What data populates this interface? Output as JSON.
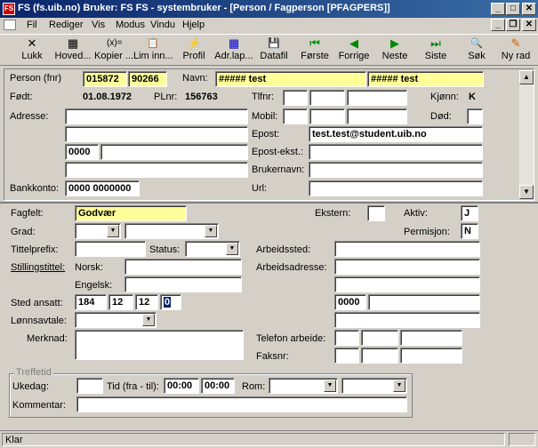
{
  "window": {
    "title": "FS (fs.uib.no) Bruker: FS  FS - systembruker - [Person / Fagperson    [PFAGPERS]]",
    "app_icon_text": "FS"
  },
  "menu": [
    "Fil",
    "Rediger",
    "Vis",
    "Modus",
    "Vindu",
    "Hjelp"
  ],
  "toolbar": [
    {
      "label": "Lukk",
      "icon": "✕"
    },
    {
      "label": "Hoved...",
      "icon": "▦"
    },
    {
      "label": "Kopier ...",
      "icon": "(x)="
    },
    {
      "label": "Lim inn...",
      "icon": "📋"
    },
    {
      "label": "Profil",
      "icon": "⚡"
    },
    {
      "label": "Adr.lap...",
      "icon": "▦"
    },
    {
      "label": "Datafil",
      "icon": "💾"
    },
    {
      "label": "Første",
      "icon": "⏮"
    },
    {
      "label": "Forrige",
      "icon": "◀"
    },
    {
      "label": "Neste",
      "icon": "▶"
    },
    {
      "label": "Siste",
      "icon": "⏭"
    },
    {
      "label": "Søk",
      "icon": "🔍"
    },
    {
      "label": "Ny rad",
      "icon": "✎"
    }
  ],
  "person": {
    "fnr_label": "Person  (fnr)",
    "fnr1": "015872",
    "fnr2": "90266",
    "navn_label": "Navn:",
    "navn1": "##### test",
    "navn2": "##### test",
    "fodt_label": "Født:",
    "fodt": "01.08.1972",
    "plnr_label": "PLnr:",
    "plnr": "156763",
    "tlfnr_label": "Tlfnr:",
    "kjonn_label": "Kjønn:",
    "kjonn": "K",
    "adresse_label": "Adresse:",
    "mobil_label": "Mobil:",
    "dod_label": "Død:",
    "epost_label": "Epost:",
    "epost": "test.test@student.uib.no",
    "postnr": "0000",
    "epost_ekst_label": "Epost-ekst.:",
    "brukernavn_label": "Brukernavn:",
    "bankkonto_label": "Bankkonto:",
    "bankkonto": "0000 0000000",
    "url_label": "Url:"
  },
  "fagperson": {
    "fagfelt_label": "Fagfelt:",
    "fagfelt": "Godvær",
    "ekstern_label": "Ekstern:",
    "aktiv_label": "Aktiv:",
    "aktiv": "J",
    "grad_label": "Grad:",
    "permisjon_label": "Permisjon:",
    "permisjon": "N",
    "tittelprefix_label": "Tittelprefix:",
    "status_label": "Status:",
    "arbeidssted_label": "Arbeidssted:",
    "stillingstittel_label": "Stillingstittel:",
    "norsk_label": "Norsk:",
    "arbeidsadresse_label": "Arbeidsadresse:",
    "engelsk_label": "Engelsk:",
    "sted_label": "Sted ansatt:",
    "sted1": "184",
    "sted2": "12",
    "sted3": "12",
    "sted4": "0",
    "arb_postnr": "0000",
    "lonnsavtale_label": "Lønnsavtale:",
    "merknad_label": "Merknad:",
    "telefon_label": "Telefon arbeide:",
    "faksnr_label": "Faksnr:"
  },
  "treffetid": {
    "legend": "Treffetid",
    "ukedag_label": "Ukedag:",
    "tid_label": "Tid (fra - til):",
    "tid_fra": "00:00",
    "tid_til": "00:00",
    "rom_label": "Rom:",
    "kommentar_label": "Kommentar:"
  },
  "status": "Klar"
}
